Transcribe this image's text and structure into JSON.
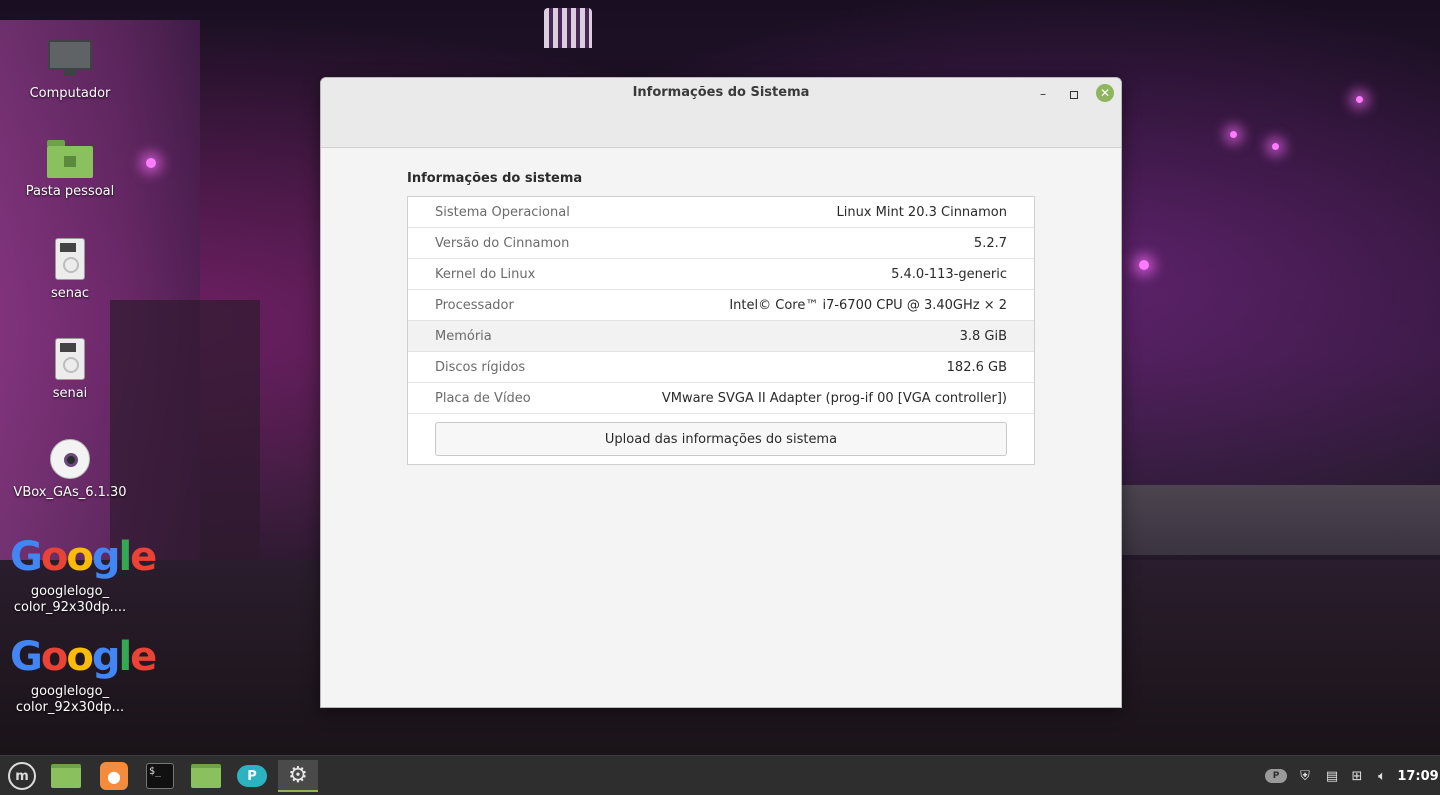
{
  "desktop": {
    "icons": [
      {
        "label": "Computador",
        "icon": "computer-icon"
      },
      {
        "label": "Pasta pessoal",
        "icon": "home-folder-icon"
      },
      {
        "label": "senac",
        "icon": "drive-icon"
      },
      {
        "label": "senai",
        "icon": "drive-icon"
      },
      {
        "label": "VBox_GAs_6.1.30",
        "icon": "cd-icon"
      },
      {
        "label": "googlelogo_\ncolor_92x30dp....",
        "icon": "image-file-icon",
        "image_text": "Google"
      },
      {
        "label": "googlelogo_\ncolor_92x30dp...",
        "icon": "image-file-icon",
        "image_text": "Google"
      }
    ]
  },
  "window": {
    "title": "Informações do Sistema",
    "controls": {
      "minimize": "–",
      "maximize": "",
      "close": "✕"
    },
    "section_title": "Informações do sistema",
    "rows": [
      {
        "label": "Sistema Operacional",
        "value": "Linux Mint 20.3 Cinnamon"
      },
      {
        "label": "Versão do Cinnamon",
        "value": "5.2.7"
      },
      {
        "label": "Kernel do Linux",
        "value": "5.4.0-113-generic"
      },
      {
        "label": "Processador",
        "value": "Intel© Core™ i7-6700 CPU @ 3.40GHz × 2"
      },
      {
        "label": "Memória",
        "value": "3.8 GiB"
      },
      {
        "label": "Discos rígidos",
        "value": "182.6 GB"
      },
      {
        "label": "Placa de Vídeo",
        "value": "VMware SVGA II Adapter (prog-if 00 [VGA controller])"
      }
    ],
    "upload_button": "Upload das informações do sistema"
  },
  "taskbar": {
    "items": [
      {
        "name": "menu-button",
        "icon": "mint-logo-icon"
      },
      {
        "name": "files-launcher",
        "icon": "folder-icon"
      },
      {
        "name": "firefox-launcher",
        "icon": "firefox-icon"
      },
      {
        "name": "terminal-launcher",
        "icon": "terminal-icon",
        "text": "$_"
      },
      {
        "name": "files-window",
        "icon": "folder-icon"
      },
      {
        "name": "pcloud-launcher",
        "icon": "pcloud-icon",
        "text": "P"
      },
      {
        "name": "system-info-window",
        "icon": "gear-icon"
      }
    ],
    "tray": {
      "cloud_badge": "P",
      "icons": [
        "cloud-icon",
        "shield-icon",
        "notes-icon",
        "network-icon",
        "volume-icon"
      ],
      "clock": "17:09"
    }
  }
}
